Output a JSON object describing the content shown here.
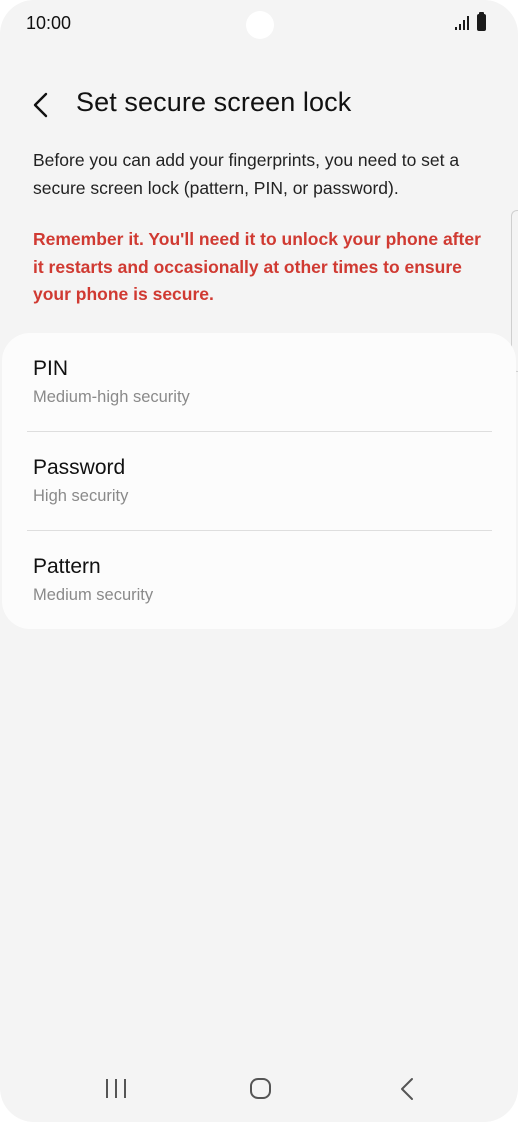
{
  "status_bar": {
    "time": "10:00",
    "icons": [
      "signal-icon",
      "battery-icon"
    ]
  },
  "header": {
    "back_icon": "chevron-left-icon",
    "title": "Set secure screen lock"
  },
  "description": "Before you can add your fingerprints, you need to set a secure screen lock (pattern, PIN, or password).",
  "warning": "Remember it. You'll need it to unlock your phone after it restarts and occasionally at other times to ensure your phone is secure.",
  "colors": {
    "warning": "#d03a32",
    "background": "#f4f4f4",
    "card": "#fcfcfc"
  },
  "options": [
    {
      "title": "PIN",
      "subtitle": "Medium-high security"
    },
    {
      "title": "Password",
      "subtitle": "High security"
    },
    {
      "title": "Pattern",
      "subtitle": "Medium security"
    }
  ],
  "nav_bar": {
    "icons": [
      "recent-apps-icon",
      "home-icon",
      "back-icon"
    ]
  }
}
